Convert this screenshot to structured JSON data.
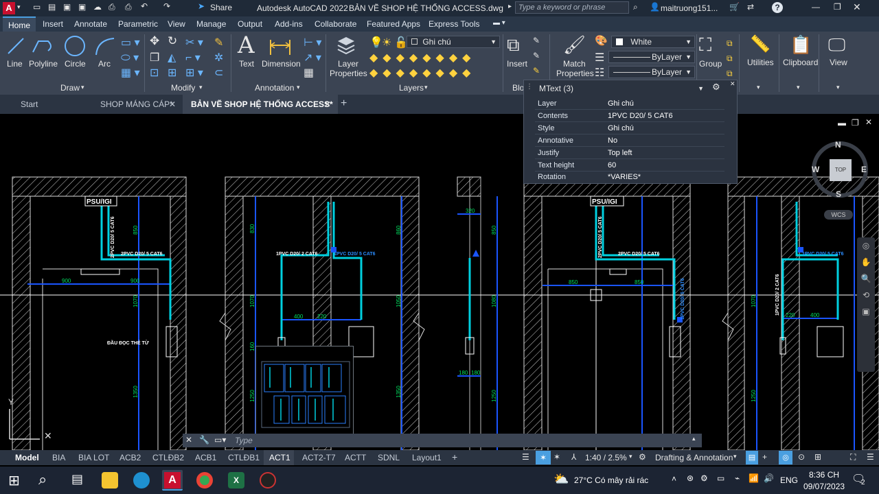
{
  "titlebar": {
    "app_title": "Autodesk AutoCAD 2022",
    "file_title": "BẢN VẼ SHOP HỆ THỐNG ACCESS.dwg",
    "share_label": "Share",
    "search_placeholder": "Type a keyword or phrase",
    "user": "maitruong151...",
    "help": "?"
  },
  "ribbon_tabs": [
    "Home",
    "Insert",
    "Annotate",
    "Parametric",
    "View",
    "Manage",
    "Output",
    "Add-ins",
    "Collaborate",
    "Featured Apps",
    "Express Tools"
  ],
  "ribbon": {
    "draw": {
      "line": "Line",
      "polyline": "Polyline",
      "circle": "Circle",
      "arc": "Arc",
      "title": "Draw"
    },
    "modify": {
      "title": "Modify"
    },
    "annotation": {
      "text": "Text",
      "dimension": "Dimension",
      "title": "Annotation"
    },
    "layers": {
      "layer_properties_line1": "Layer",
      "layer_properties_line2": "Properties",
      "current_layer": "Ghi chú",
      "title": "Layers"
    },
    "block": {
      "insert": "Insert",
      "title": "Blo"
    },
    "properties": {
      "match_line1": "Match",
      "match_line2": "Properties",
      "color": "White",
      "linetype": "ByLayer",
      "lineweight": "ByLayer"
    },
    "groups": {
      "group": "Group"
    },
    "utilities": "Utilities",
    "clipboard": "Clipboard",
    "view": "View"
  },
  "doc_tabs": {
    "start": "Start",
    "tab1": "SHOP MÁNG CÁP*",
    "tab2": "BẢN VẼ SHOP HỆ THỐNG ACCESS*"
  },
  "props_panel": {
    "selector": "MText (3)",
    "rows": [
      {
        "key": "Layer",
        "value": "Ghi chú"
      },
      {
        "key": "Contents",
        "value": "1PVC D20/ 5 CAT6"
      },
      {
        "key": "Style",
        "value": "Ghi chú"
      },
      {
        "key": "Annotative",
        "value": "No"
      },
      {
        "key": "Justify",
        "value": "Top left"
      },
      {
        "key": "Text height",
        "value": "60"
      },
      {
        "key": "Rotation",
        "value": "*VARIES*"
      }
    ]
  },
  "viewcube": {
    "n": "N",
    "s": "S",
    "e": "E",
    "w": "W",
    "top": "TOP",
    "wcs": "WCS"
  },
  "drawing": {
    "psu1": "PSU/IGI",
    "psu2": "PSU/IGI",
    "cable_2pvc_5cat6": "2PVC D20/ 5 CAT6",
    "cable_1pvc_2cat6": "1PVC D20/ 2 CAT6",
    "cable_1pvc_5cat6": "1PVC D20/ 5 CAT6",
    "reader_label": "ĐẦU ĐỌC THẺ TỪ",
    "dims": {
      "d900a": "900",
      "d900b": "900",
      "d400": "400",
      "d220": "220",
      "d320": "320",
      "d180a": "180",
      "d180b": "180",
      "d850a": "850",
      "d850b": "850",
      "d220b": "220",
      "d400b": "400",
      "d1070a": "1070",
      "d1050": "1050",
      "d1080": "1080",
      "d1250": "1250",
      "d1350": "1350",
      "d830": "830",
      "d860": "860",
      "d850c": "850",
      "d160": "160",
      "d1070b": "1070"
    }
  },
  "cmdline_placeholder": "Type",
  "layout_tabs": [
    "Model",
    "BIA",
    "BIA LOT",
    "ACB2",
    "CTLĐB2",
    "ACB1",
    "CTLĐB1",
    "ACT1",
    "ACT2-T7",
    "ACTT",
    "SDNL",
    "Layout1"
  ],
  "active_layout": "ACT1",
  "status": {
    "scale": "1:40 / 2.5%",
    "workspace": "Drafting & Annotation"
  },
  "taskbar": {
    "weather": "27°C  Có mây rải rác",
    "lang": "ENG",
    "time": "8:36 CH",
    "date": "09/07/2023",
    "notif": "2"
  },
  "colors": {
    "cyan": "#00d0e0",
    "blue": "#1a55ff",
    "white": "#ffffff",
    "accent": "#4a9fe0"
  }
}
